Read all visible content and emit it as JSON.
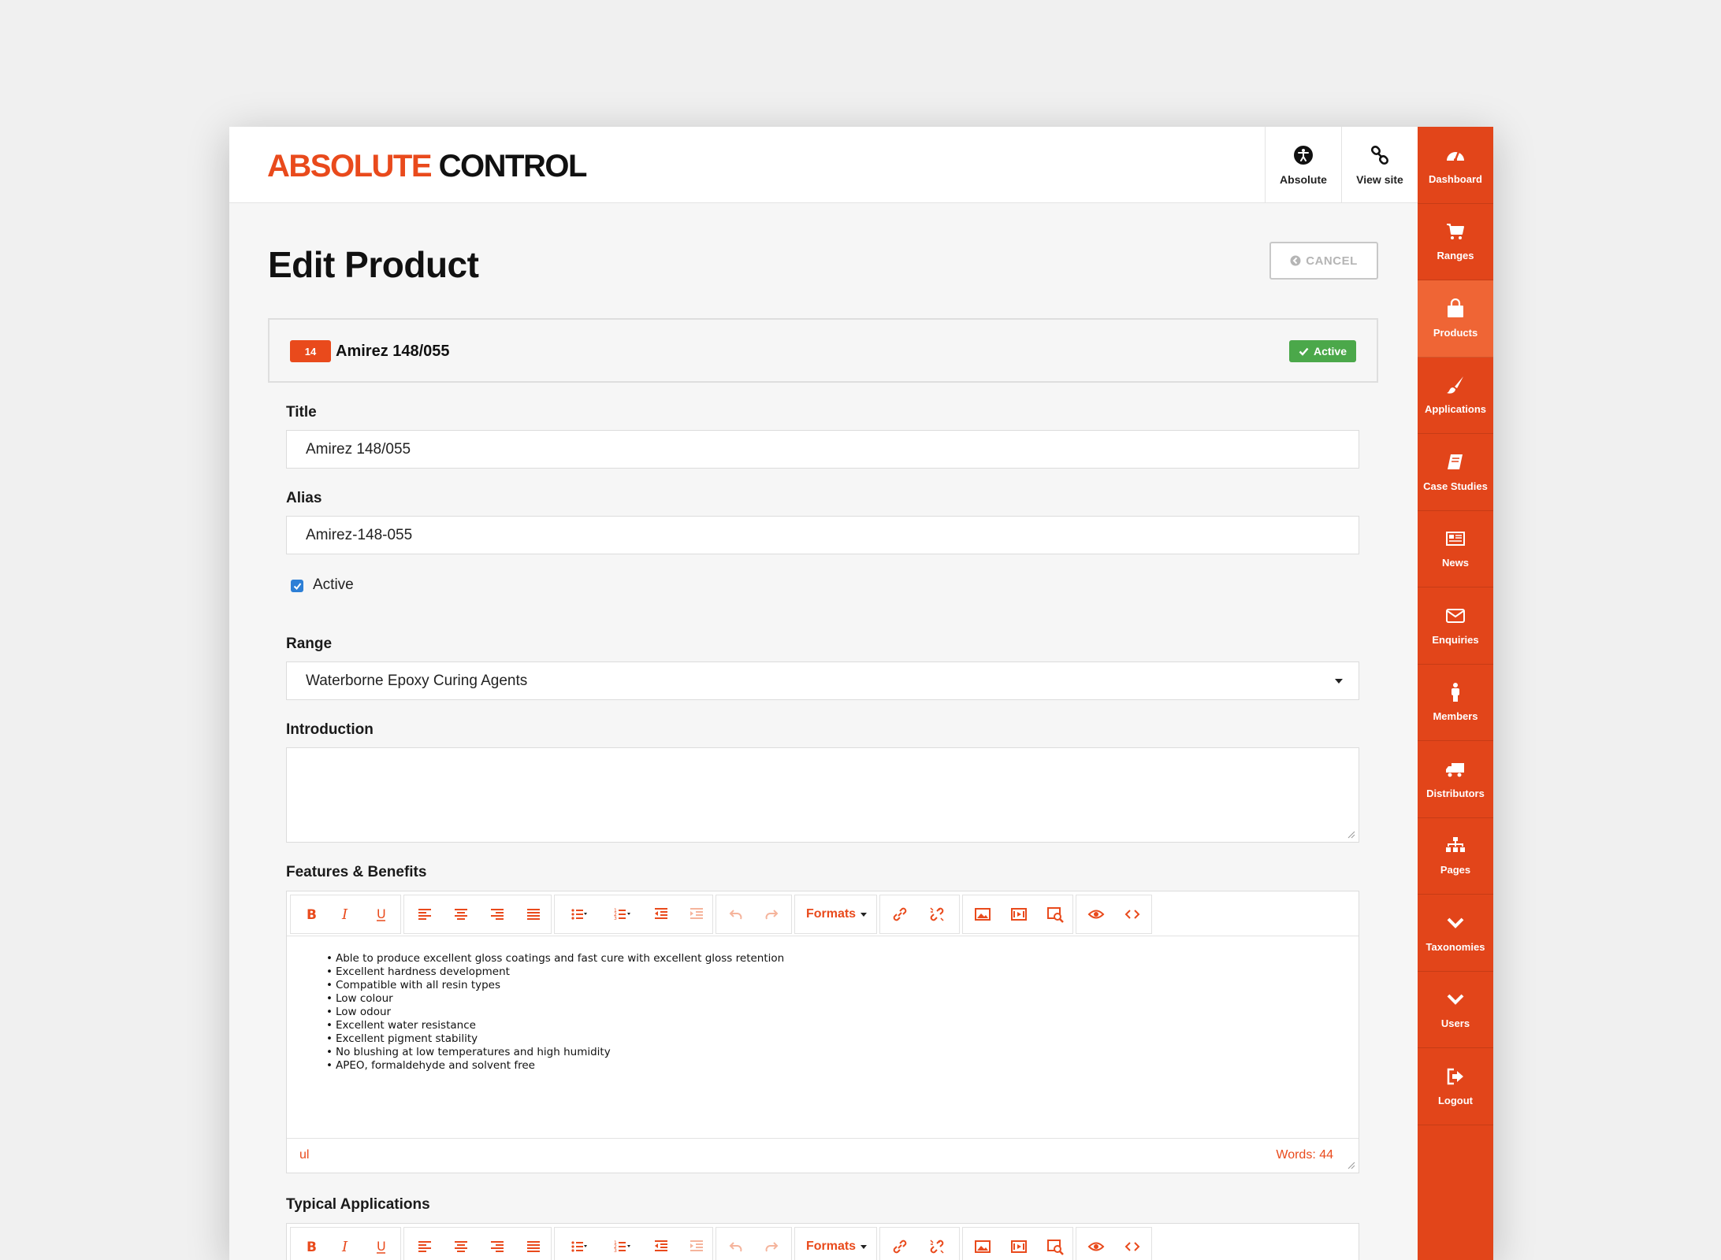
{
  "brand": {
    "part1": "ABSOLUTE",
    "part2": "CONTROL",
    "accent": "#e94a1c"
  },
  "header": {
    "buttons": [
      {
        "label": "Absolute",
        "icon": "accessibility-icon"
      },
      {
        "label": "View site",
        "icon": "link-icon"
      }
    ]
  },
  "sidebar": {
    "items": [
      {
        "label": "Dashboard",
        "icon": "dashboard-icon"
      },
      {
        "label": "Ranges",
        "icon": "cart-icon"
      },
      {
        "label": "Products",
        "icon": "shopping-bag-icon",
        "active": true
      },
      {
        "label": "Applications",
        "icon": "paint-brush-icon"
      },
      {
        "label": "Case Studies",
        "icon": "book-icon"
      },
      {
        "label": "News",
        "icon": "newspaper-icon"
      },
      {
        "label": "Enquiries",
        "icon": "envelope-icon"
      },
      {
        "label": "Members",
        "icon": "person-icon"
      },
      {
        "label": "Distributors",
        "icon": "truck-icon"
      },
      {
        "label": "Pages",
        "icon": "sitemap-icon"
      },
      {
        "label": "Taxonomies",
        "icon": "chevron-down-icon"
      },
      {
        "label": "Users",
        "icon": "chevron-down-icon"
      },
      {
        "label": "Logout",
        "icon": "sign-out-icon"
      }
    ]
  },
  "page": {
    "title": "Edit Product",
    "cancel_label": "CANCEL"
  },
  "record": {
    "id": "14",
    "name": "Amirez 148/055",
    "status": "Active",
    "status_color": "#4ba84a"
  },
  "form": {
    "title_label": "Title",
    "title_value": "Amirez 148/055",
    "alias_label": "Alias",
    "alias_value": "Amirez-148-055",
    "active_label": "Active",
    "active_checked": true,
    "range_label": "Range",
    "range_value": "Waterborne Epoxy Curing Agents",
    "intro_label": "Introduction",
    "intro_value": "",
    "features_label": "Features & Benefits",
    "typical_label": "Typical Applications"
  },
  "editor": {
    "formats_label": "Formats",
    "features_items": [
      "Able to produce excellent gloss coatings and fast cure with excellent gloss retention",
      "Excellent hardness development",
      "Compatible with all resin types",
      "Low colour",
      "Low odour",
      "Excellent water resistance",
      "Excellent pigment stability",
      "No blushing at low temperatures and high humidity",
      "APEO, formaldehyde and solvent free"
    ],
    "path": "ul",
    "word_count": "Words: 44"
  }
}
